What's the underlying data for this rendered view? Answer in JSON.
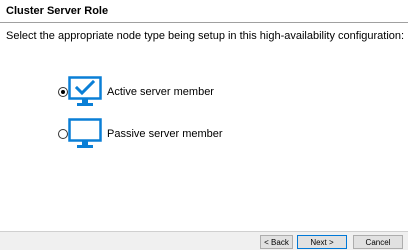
{
  "header": {
    "title": "Cluster Server Role"
  },
  "instruction": "Select the appropriate node type being setup in this high-availability configuration:",
  "options": [
    {
      "label": "Active server member",
      "selected": true,
      "icon": "monitor-check-icon"
    },
    {
      "label": "Passive server member",
      "selected": false,
      "icon": "monitor-icon"
    }
  ],
  "buttons": {
    "back": "< Back",
    "next": "Next >",
    "cancel": "Cancel"
  },
  "colors": {
    "accent": "#0a7fd6",
    "monitor_stand": "#0a7fd6"
  }
}
